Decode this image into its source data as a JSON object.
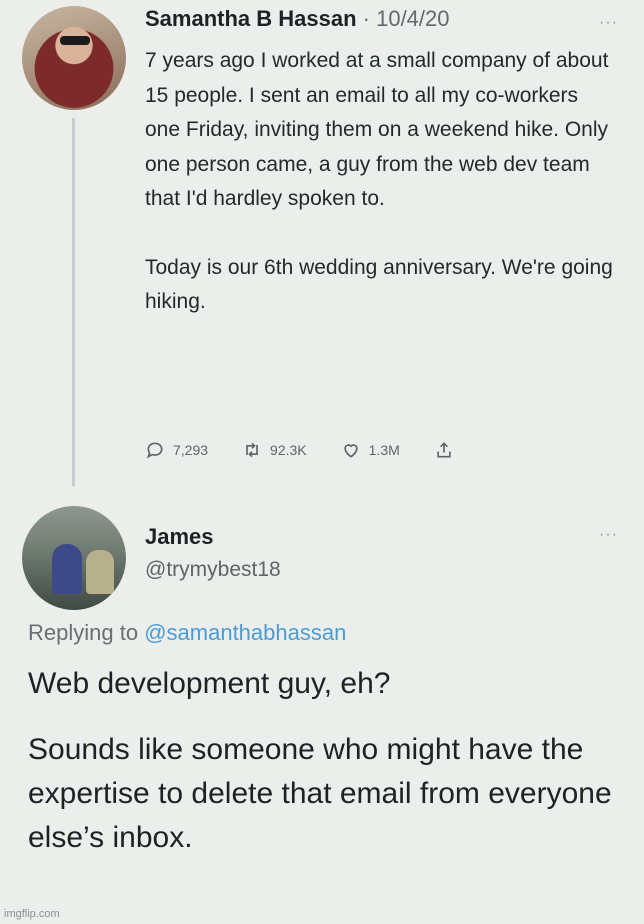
{
  "tweet1": {
    "author_name": "Samantha B Hassan",
    "date": "· 10/4/20",
    "more": "···",
    "paragraph1": "7 years ago I worked at a small company of about 15 people. I sent an email to all my co-workers one Friday, inviting them on a weekend hike. Only one person came, a guy from the web dev team that I'd hardley spoken to.",
    "paragraph2": "Today is our 6th wedding anniversary. We're going hiking.",
    "actions": {
      "replies": "7,293",
      "retweets": "92.3K",
      "likes": "1.3M"
    },
    "icons": [
      "reply-icon",
      "retweet-icon",
      "heart-icon",
      "share-icon"
    ]
  },
  "tweet2": {
    "author_name": "James",
    "handle": "@trymybest18",
    "more": "···",
    "replying_prefix": "Replying to",
    "replying_handle": "@samanthabhassan",
    "paragraph1": "Web development guy, eh?",
    "paragraph2": "Sounds like someone who might have the expertise to delete that email from everyone else’s inbox."
  },
  "watermark": "imgflip.com",
  "colors": {
    "background": "#eceeeb",
    "link": "#4c9bd2",
    "text": "#1e2226",
    "muted": "#64696e"
  }
}
